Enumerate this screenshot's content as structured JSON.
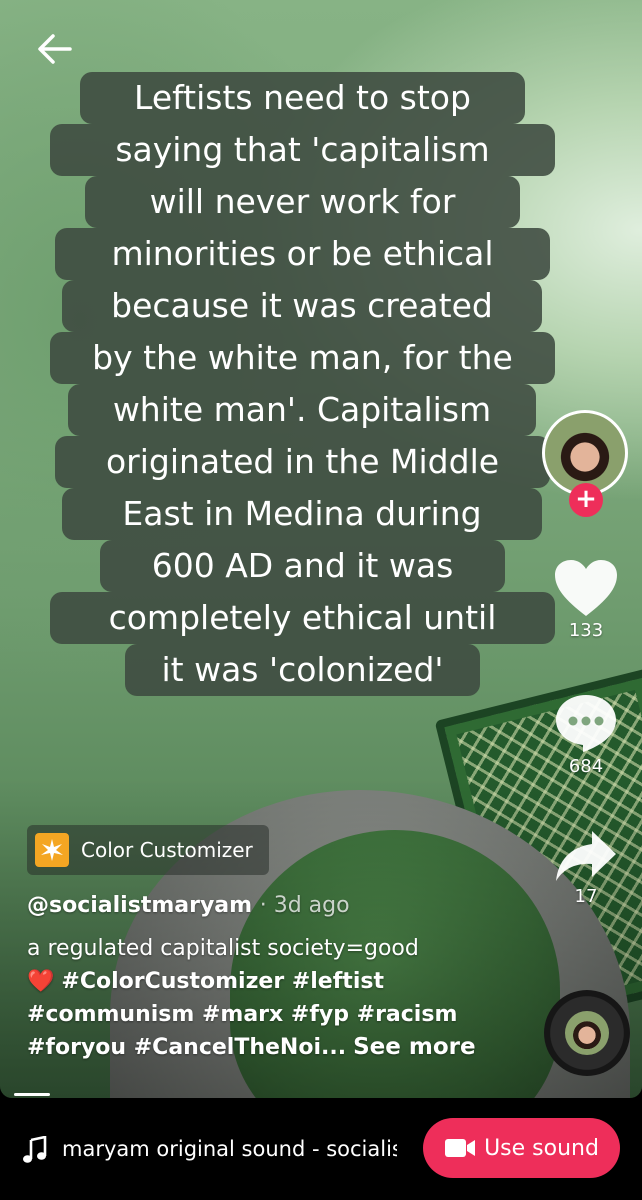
{
  "caption": {
    "lines": [
      "Leftists need to stop",
      "saying that 'capitalism",
      "will never work for",
      "minorities or be ethical",
      "because it was created",
      "by the white man, for the",
      "white man'. Capitalism",
      "originated in the Middle",
      "East in  Medina during",
      "600 AD and it was",
      "completely ethical until",
      "it was 'colonized'"
    ]
  },
  "actions": {
    "likes": "133",
    "comments": "684",
    "shares": "17"
  },
  "effect": {
    "label": "Color Customizer"
  },
  "post": {
    "username": "@socialistmaryam",
    "time_ago": "· 3d ago",
    "description": "a regulated capitalist society=good",
    "heart_emoji": "❤️",
    "hashtags_line1": "#ColorCustomizer #leftist",
    "hashtags_line2": "#communism #marx #fyp #racism",
    "hashtags_line3": "#foryou #CancelTheNoi...",
    "see_more": "See more"
  },
  "sound": {
    "text": "maryam    original sound - socialistmaryam",
    "use_sound_label": "Use sound"
  },
  "colors": {
    "accent": "#ee2e5a",
    "caption_bg": "#3e4a40"
  },
  "icons": [
    "back-arrow-icon",
    "plus-icon",
    "heart-icon",
    "comment-icon",
    "share-icon",
    "music-note-icon",
    "video-camera-icon"
  ]
}
